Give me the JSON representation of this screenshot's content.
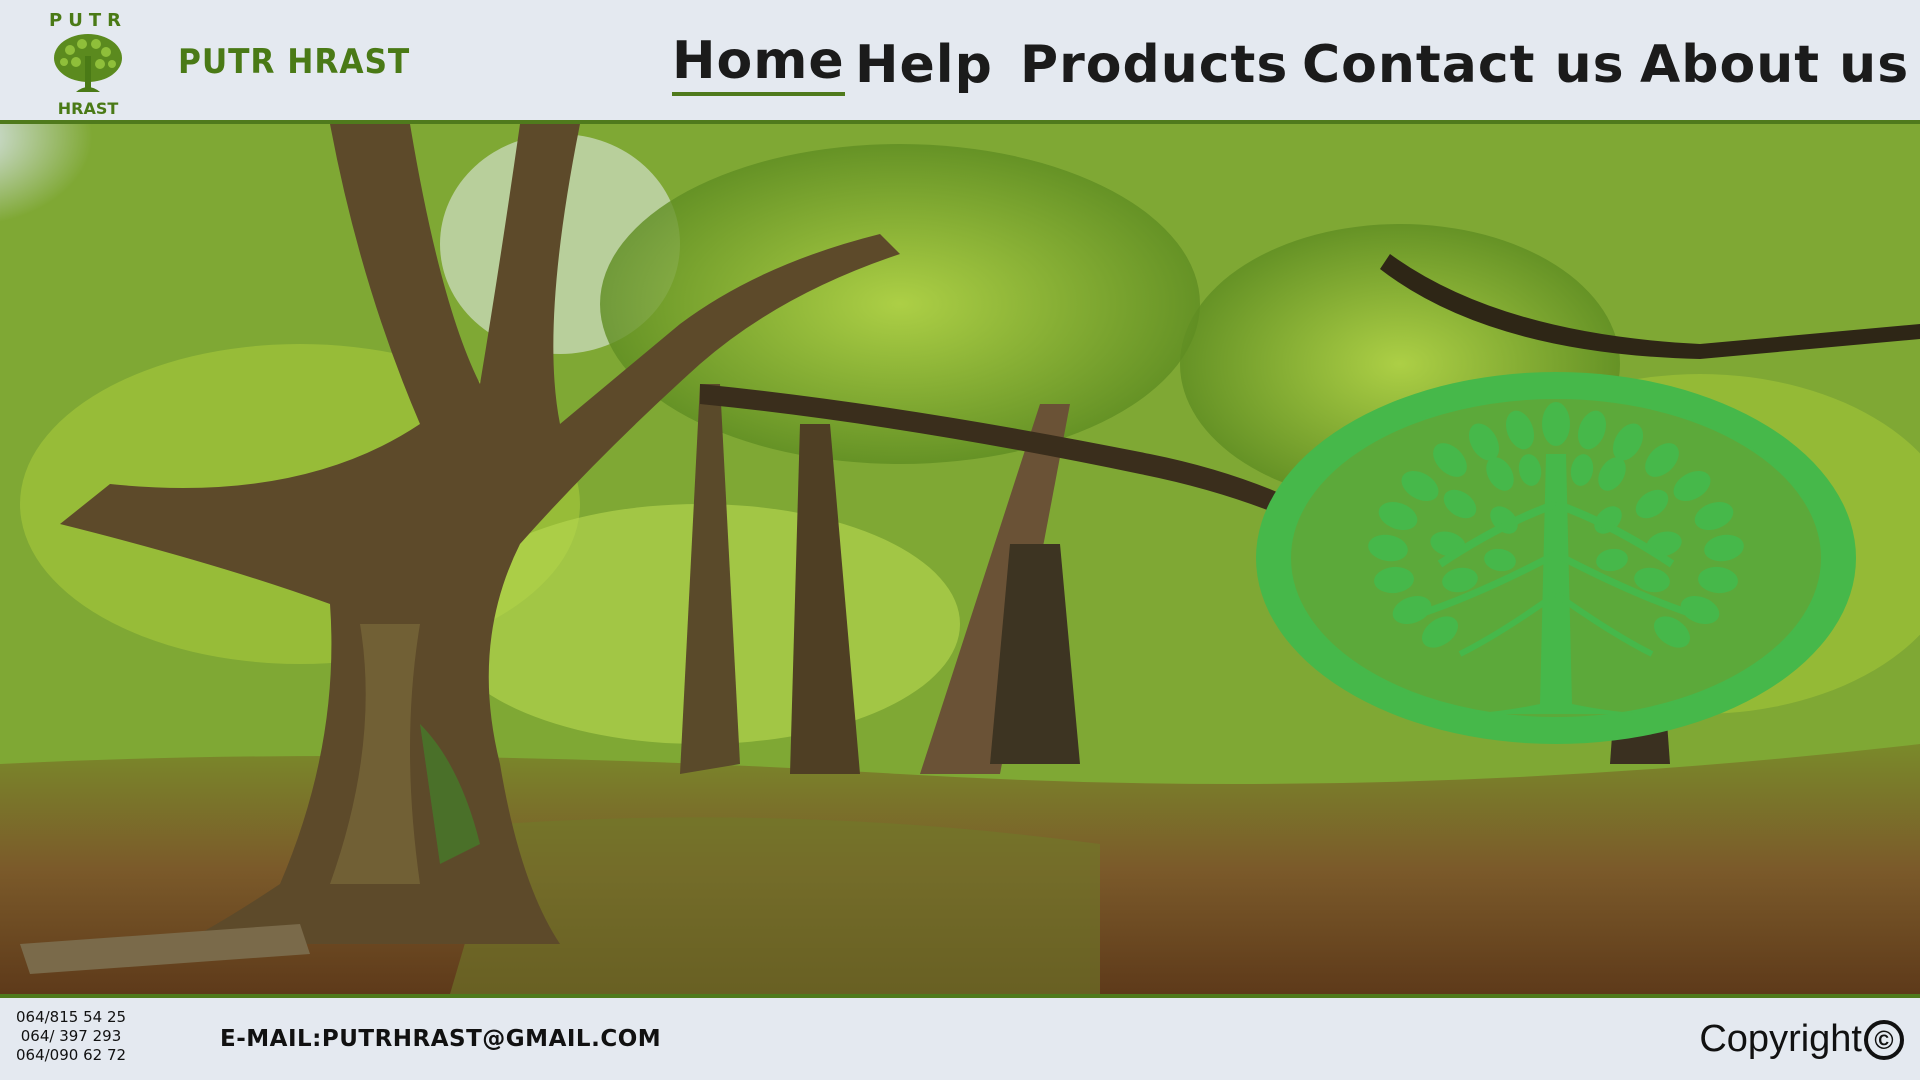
{
  "header": {
    "logo": {
      "top_text": "PUTR",
      "bottom_text": "HRAST",
      "icon": "tree-icon"
    },
    "brand_name": "PUTR HRAST",
    "nav": [
      {
        "label": "Home",
        "active": true
      },
      {
        "label": "Help",
        "active": false
      },
      {
        "label": "Products",
        "active": false
      },
      {
        "label": "Contact us",
        "active": false
      },
      {
        "label": "About us",
        "active": false
      }
    ]
  },
  "hero": {
    "image": "forest-photo",
    "emblem_icon": "tree-of-life-icon"
  },
  "footer": {
    "phones": [
      "064/815 54 25",
      "064/ 397 293",
      "064/090 62 72"
    ],
    "email": "E-MAIL:PUTRHRAST@GMAIL.COM",
    "copyright_label": "Copyright",
    "copyright_icon": "©"
  },
  "colors": {
    "brand_green": "#4a7a16",
    "divider_green": "#4f7a1c",
    "emblem_green": "#46b84a",
    "background": "#e4e9f0"
  }
}
